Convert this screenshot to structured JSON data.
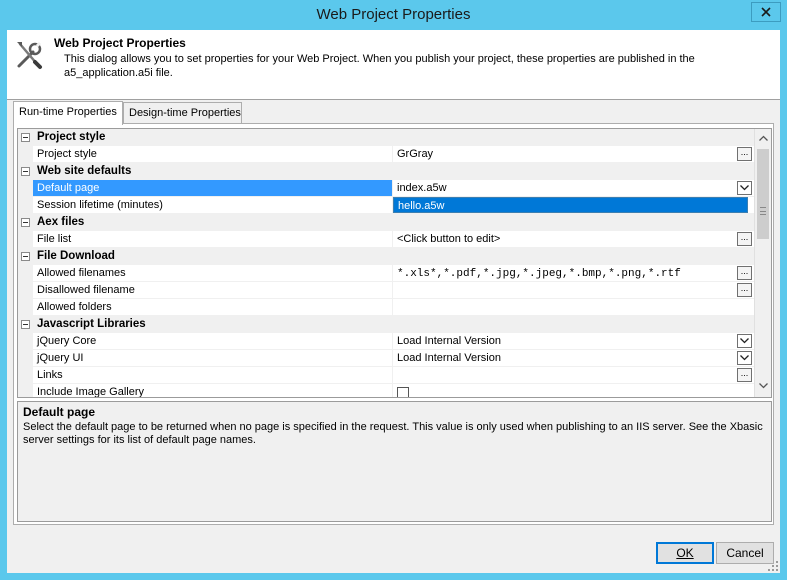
{
  "window": {
    "title": "Web Project Properties"
  },
  "header": {
    "title": "Web Project Properties",
    "description": "This dialog allows you to set properties for your Web Project. When you publish your project, these properties are published in the a5_application.a5i file.",
    "icon": "tools-icon"
  },
  "tabs": [
    {
      "label": "Run-time Properties",
      "active": true
    },
    {
      "label": "Design-time Properties",
      "active": false
    }
  ],
  "grid": {
    "categories": {
      "project_style": "Project style",
      "web_site_defaults": "Web site defaults",
      "aex_files": "Aex files",
      "file_download": "File Download",
      "javascript_libraries": "Javascript Libraries"
    },
    "props": {
      "project_style": {
        "name": "Project style",
        "value": "GrGray"
      },
      "default_page": {
        "name": "Default page",
        "value": "index.a5w"
      },
      "session_lifetime": {
        "name": "Session lifetime (minutes)",
        "value": ""
      },
      "file_list": {
        "name": "File list",
        "value": "<Click button to edit>"
      },
      "allowed_filenames": {
        "name": "Allowed filenames",
        "value": "*.xls*,*.pdf,*.jpg,*.jpeg,*.bmp,*.png,*.rtf"
      },
      "disallowed_filename": {
        "name": "Disallowed filename",
        "value": ""
      },
      "allowed_folders": {
        "name": "Allowed folders",
        "value": ""
      },
      "jquery_core": {
        "name": "jQuery Core",
        "value": "Load Internal Version"
      },
      "jquery_ui": {
        "name": "jQuery UI",
        "value": "Load Internal Version"
      },
      "links": {
        "name": "Links",
        "value": ""
      },
      "include_image_gallery": {
        "name": "Include Image Gallery",
        "checked": false
      }
    },
    "dropdown_open_option": "hello.a5w",
    "ellipsis": "..."
  },
  "help": {
    "title": "Default page",
    "text": "Select the default page to be returned when no page is specified in the request. This value is only used when publishing to an IIS server. See the Xbasic server settings for its list of default page names."
  },
  "buttons": {
    "ok": "OK",
    "cancel": "Cancel"
  },
  "colors": {
    "titlebar": "#5bc8ec",
    "selection": "#3399ff",
    "dropdown_highlight": "#0078d7",
    "dialog_bg": "#f0f0f0"
  }
}
